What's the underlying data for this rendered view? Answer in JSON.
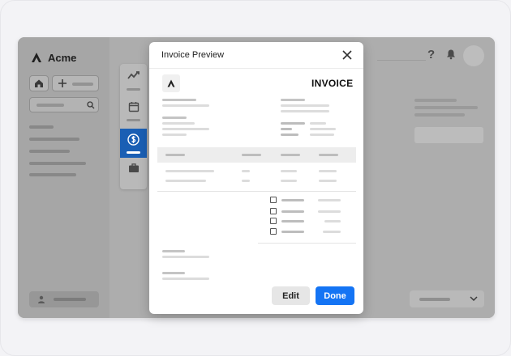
{
  "app": {
    "name": "Acme",
    "logo_icon": "acme-logo-icon"
  },
  "sidebar": {
    "home_icon": "home-icon",
    "add_icon": "plus-icon",
    "search_icon": "search-icon",
    "user_icon": "user-icon"
  },
  "header": {
    "help_label": "?",
    "bell_icon": "bell-icon",
    "avatar": "avatar"
  },
  "toolstrip": {
    "items": [
      {
        "icon": "chart-icon"
      },
      {
        "icon": "calendar-icon"
      },
      {
        "icon": "dollar-icon",
        "active": true
      },
      {
        "icon": "briefcase-icon"
      }
    ]
  },
  "modal": {
    "title": "Invoice Preview",
    "close_icon": "close-icon",
    "invoice_heading": "INVOICE",
    "edit_label": "Edit",
    "done_label": "Done"
  },
  "colors": {
    "accent": "#1474f4",
    "active_tool": "#1a5fb4"
  }
}
